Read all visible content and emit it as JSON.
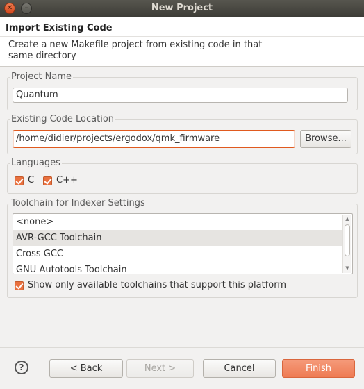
{
  "window": {
    "title": "New Project"
  },
  "header": {
    "title": "Import Existing Code",
    "description": "Create a new Makefile project from existing code in that same directory"
  },
  "project_name": {
    "label": "Project Name",
    "value": "Quantum"
  },
  "code_location": {
    "label": "Existing Code Location",
    "value": "/home/didier/projects/ergodox/qmk_firmware",
    "browse_label": "Browse..."
  },
  "languages": {
    "label": "Languages",
    "items": [
      {
        "label": "C",
        "checked": true
      },
      {
        "label": "C++",
        "checked": true
      }
    ]
  },
  "toolchain": {
    "label": "Toolchain for Indexer Settings",
    "items": [
      "<none>",
      "AVR-GCC Toolchain",
      "Cross GCC",
      "GNU Autotools Toolchain"
    ],
    "selected": "AVR-GCC Toolchain",
    "filter_label": "Show only available toolchains that support this platform",
    "filter_checked": true
  },
  "buttons": {
    "back": "< Back",
    "next": "Next >",
    "cancel": "Cancel",
    "finish": "Finish"
  },
  "colors": {
    "accent": "#e9713f",
    "finish": "#ee7b53",
    "titlebar": "#3d3c37"
  }
}
